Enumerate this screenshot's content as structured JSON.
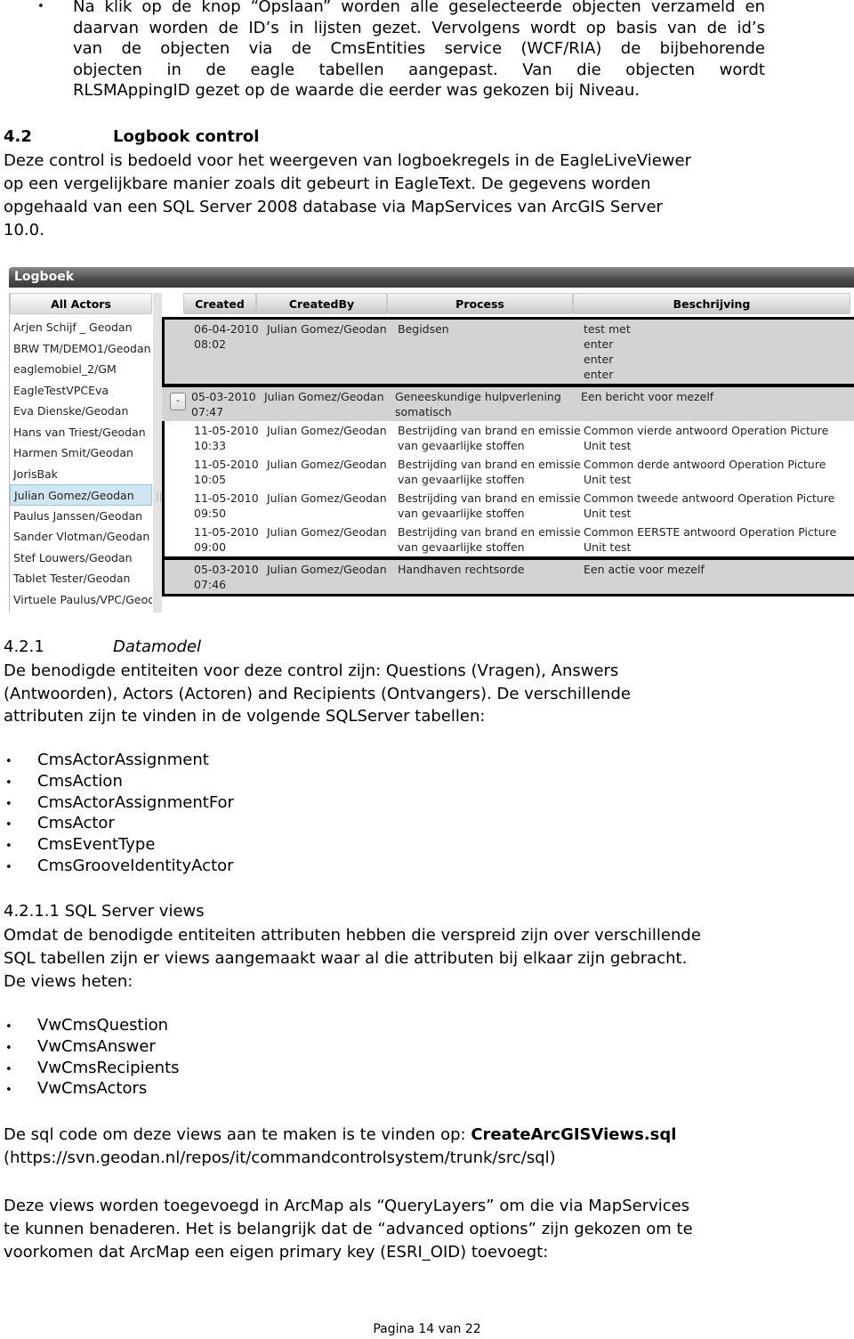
{
  "intro_bullet": {
    "lines": [
      "Na klik op de knop “Opslaan” worden alle geselecteerde objecten verzameld en",
      "daarvan worden de ID’s in lijsten gezet. Vervolgens wordt op basis van de id’s",
      "van de objecten via de CmsEntities service (WCF/RIA) de bijbehorende",
      "objecten in de eagle tabellen aangepast. Van die objecten wordt",
      "RLSMAppingID gezet op de waarde die eerder was gekozen bij Niveau."
    ]
  },
  "section_4_2": {
    "number": "4.2",
    "title": "Logbook control",
    "lines": [
      "Deze control is bedoeld voor het weergeven van logboekregels in de EagleLiveViewer",
      "op een vergelijkbare manier zoals dit gebeurt in EagleText. De gegevens worden",
      "opgehaald van een SQL Server 2008 database via MapServices van ArcGIS Server",
      "10.0."
    ]
  },
  "logboek": {
    "title": "Logboek",
    "actors_header": "All Actors",
    "actors": [
      "Arjen Schijf _ Geodan",
      "BRW TM/DEMO1/Geodan",
      "eaglemobiel_2/GM",
      "EagleTestVPCEva",
      "Eva Dienske/Geodan",
      "Hans van Triest/Geodan",
      "Harmen Smit/Geodan",
      "JorisBak",
      "Julian Gomez/Geodan",
      "Paulus Janssen/Geodan",
      "Sander Vlotman/Geodan",
      "Stef Louwers/Geodan",
      "Tablet Tester/Geodan",
      "Virtuele Paulus/VPC/Geod"
    ],
    "selected_actor": "Julian Gomez/Geodan",
    "splitter_grip": "||",
    "collapse_label": "-",
    "columns": [
      "Created",
      "CreatedBy",
      "Process",
      "Beschrijving"
    ],
    "rows": [
      {
        "created": [
          "06-04-2010",
          "08:02"
        ],
        "by": "Julian Gomez/Geodan",
        "process": [
          "Begidsen"
        ],
        "desc": [
          "test met",
          "enter",
          "enter",
          "enter"
        ]
      },
      {
        "created": [
          "05-03-2010",
          "07:47"
        ],
        "by": "Julian Gomez/Geodan",
        "process": [
          "Geneeskundige hulpverlening",
          "somatisch"
        ],
        "desc": [
          "Een bericht voor mezelf"
        ]
      },
      {
        "created": [
          "11-05-2010",
          "10:33"
        ],
        "by": "Julian Gomez/Geodan",
        "process": [
          "Bestrijding van brand en emissie",
          "van gevaarlijke stoffen"
        ],
        "desc": [
          "Common vierde antwoord Operation Picture",
          "Unit test"
        ]
      },
      {
        "created": [
          "11-05-2010",
          "10:05"
        ],
        "by": "Julian Gomez/Geodan",
        "process": [
          "Bestrijding van brand en emissie",
          "van gevaarlijke stoffen"
        ],
        "desc": [
          "Common derde antwoord Operation Picture",
          "Unit test"
        ]
      },
      {
        "created": [
          "11-05-2010",
          "09:50"
        ],
        "by": "Julian Gomez/Geodan",
        "process": [
          "Bestrijding van brand en emissie",
          "van gevaarlijke stoffen"
        ],
        "desc": [
          "Common tweede antwoord Operation Picture",
          "Unit test"
        ]
      },
      {
        "created": [
          "11-05-2010",
          "09:00"
        ],
        "by": "Julian Gomez/Geodan",
        "process": [
          "Bestrijding van brand en emissie",
          "van gevaarlijke stoffen"
        ],
        "desc": [
          "Common EERSTE antwoord Operation Picture",
          "Unit test"
        ]
      },
      {
        "created": [
          "05-03-2010",
          "07:46"
        ],
        "by": "Julian Gomez/Geodan",
        "process": [
          "Handhaven rechtsorde"
        ],
        "desc": [
          "Een actie voor mezelf"
        ]
      }
    ]
  },
  "section_4_2_1": {
    "number": "4.2.1",
    "title": "Datamodel",
    "lines": [
      "De benodigde entiteiten voor deze control zijn: Questions (Vragen), Answers",
      "(Antwoorden), Actors (Actoren) and Recipients (Ontvangers). De verschillende",
      "attributen zijn te vinden in de volgende SQLServer tabellen:"
    ],
    "tables": [
      "CmsActorAssignment",
      "CmsAction",
      "CmsActorAssignmentFor",
      "CmsActor",
      "CmsEventType",
      "CmsGrooveIdentityActor"
    ]
  },
  "section_4_2_1_1": {
    "heading": "4.2.1.1 SQL Server views",
    "lines": [
      "Omdat de benodigde entiteiten attributen hebben die verspreid zijn over verschillende",
      "SQL tabellen zijn er views aangemaakt waar al die attributen bij elkaar zijn gebracht.",
      "De views heten:"
    ],
    "views": [
      "VwCmsQuestion",
      "VwCmsAnswer",
      "VwCmsRecipients",
      "VwCmsActors"
    ],
    "sql_prefix": "De sql code om deze views aan te maken is te vinden op: ",
    "sql_file": "CreateArcGISViews.sql",
    "sql_url": "(https://svn.geodan.nl/repos/it/commandcontrolsystem/trunk/src/sql)",
    "closing_lines": [
      "Deze views worden toegevoegd in ArcMap als “QueryLayers” om die via MapServices",
      "te kunnen benaderen. Het is belangrijk dat de “advanced options” zijn gekozen om te",
      "voorkomen dat ArcMap een eigen primary key (ESRI_OID) toevoegt:"
    ]
  },
  "footer": "Pagina 14 van 22",
  "bullet_glyph": "•"
}
